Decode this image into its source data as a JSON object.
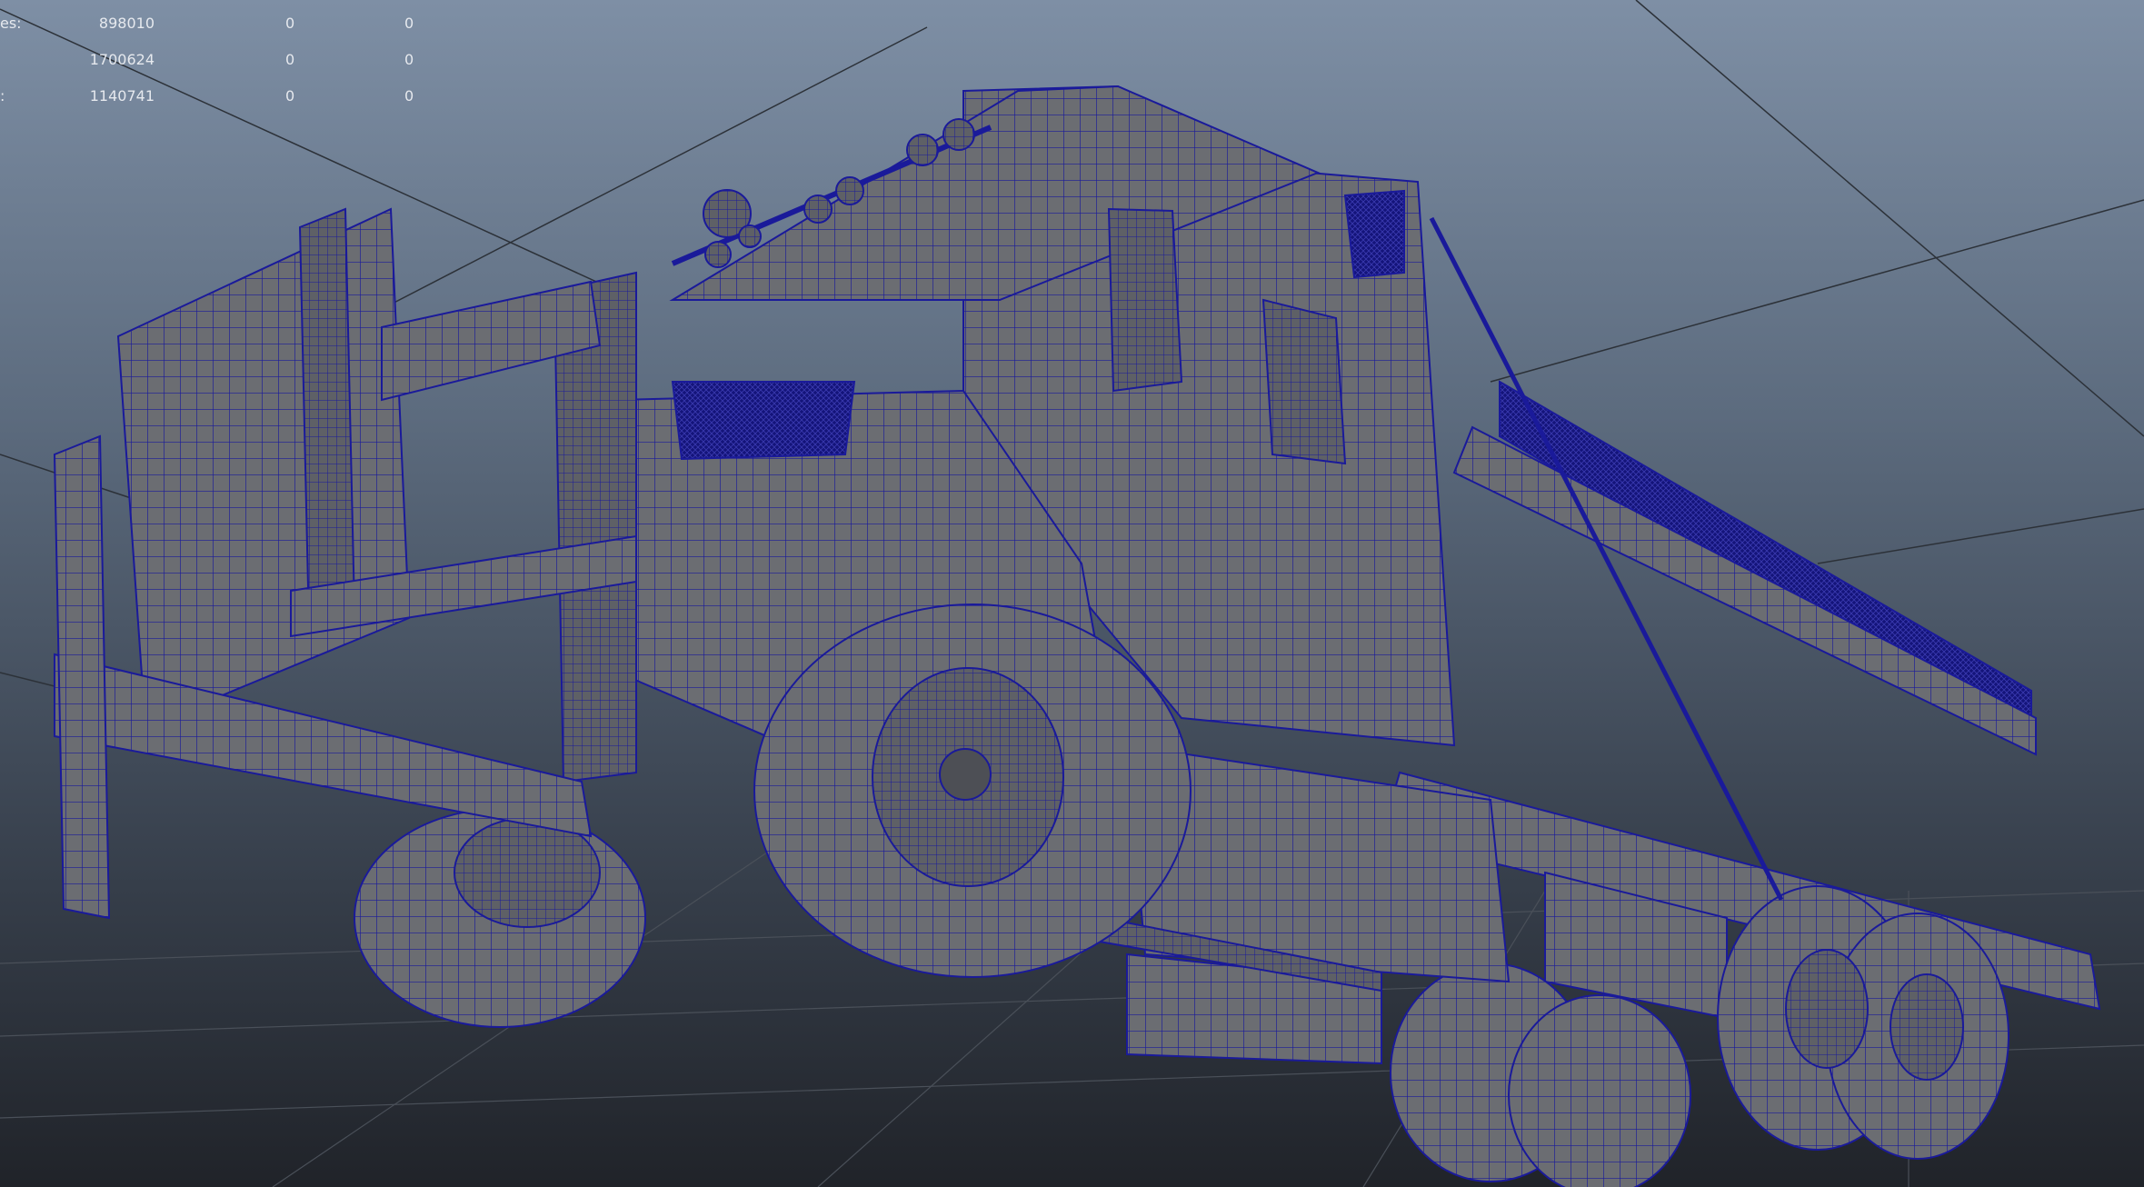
{
  "viewport": {
    "background_top": "#7e8fa5",
    "background_bottom": "#202329",
    "wireframe_color": "#1a1a9a",
    "mesh_color": "#6b6d72"
  },
  "heads_up_display": {
    "rows": [
      {
        "label": "es:",
        "total": "898010",
        "selected": "0",
        "components": "0"
      },
      {
        "label": "",
        "total": "1700624",
        "selected": "0",
        "components": "0"
      },
      {
        "label": ":",
        "total": "1140741",
        "selected": "0",
        "components": "0"
      }
    ]
  }
}
